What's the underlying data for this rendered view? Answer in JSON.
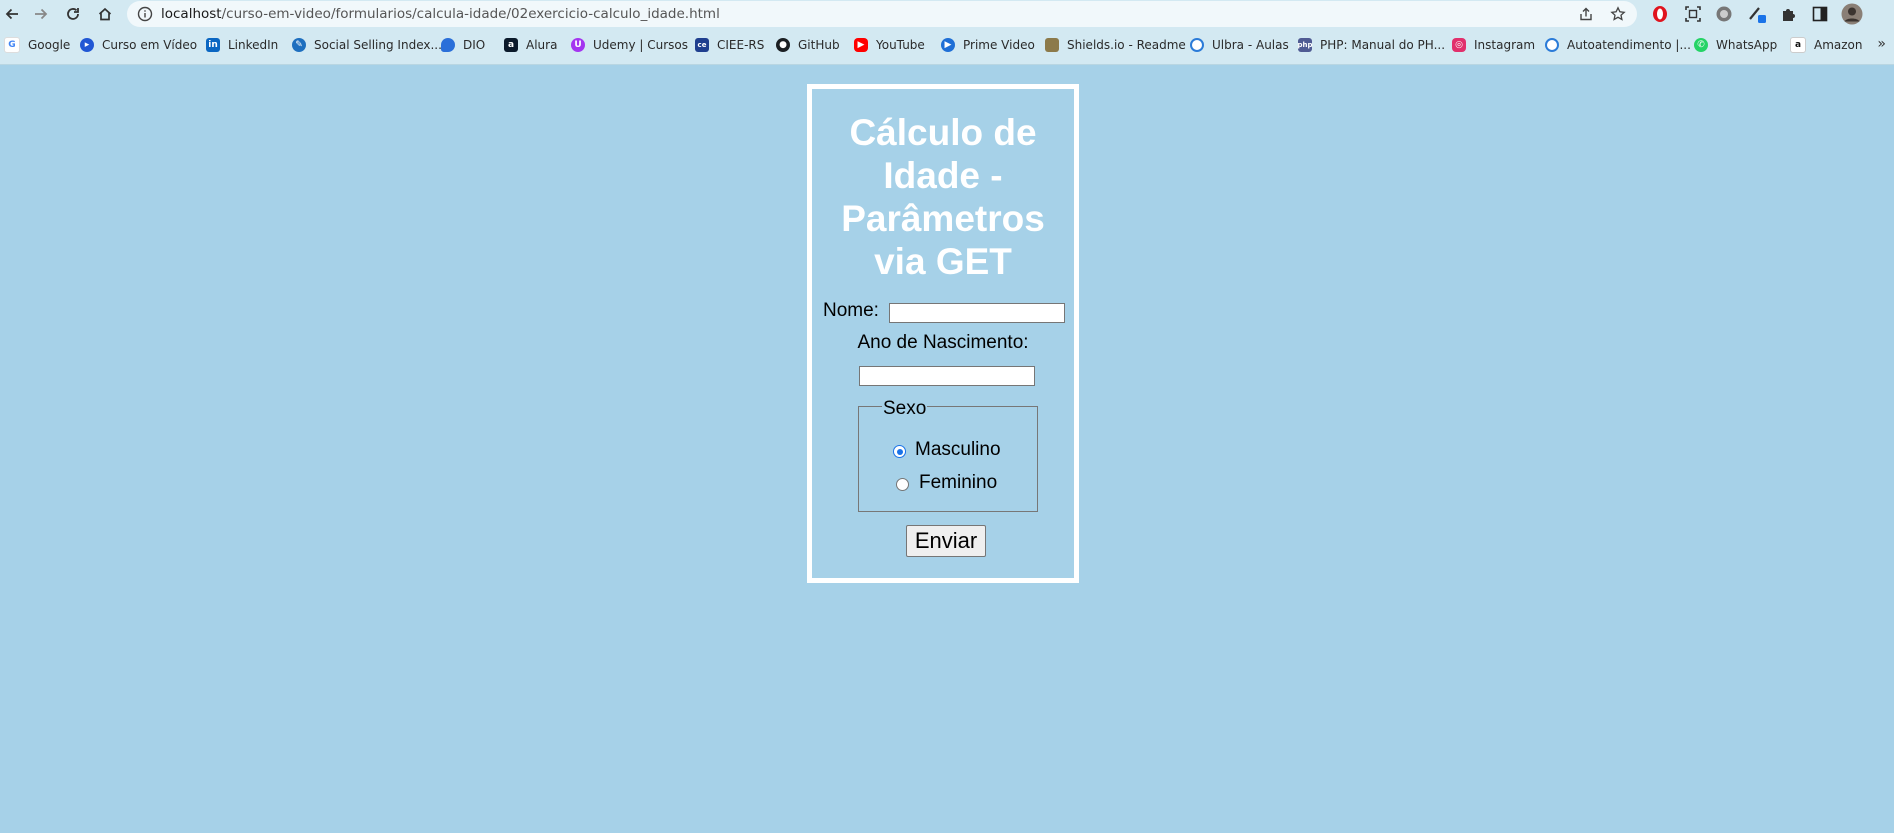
{
  "browser": {
    "url_host": "localhost",
    "url_path": "/curso-em-video/formularios/calcula-idade/02exercicio-calculo_idade.html",
    "bookmarks": [
      {
        "label": "Google",
        "icon": "google-icon",
        "color": "#4285f4"
      },
      {
        "label": "Curso em Vídeo",
        "icon": "cursoemvideo-icon",
        "color": "#2157d4"
      },
      {
        "label": "LinkedIn",
        "icon": "linkedin-icon",
        "color": "#0a66c2"
      },
      {
        "label": "Social Selling Index...",
        "icon": "social-selling-icon",
        "color": "#1e6fbf"
      },
      {
        "label": "DIO",
        "icon": "dio-icon",
        "color": "#2a6fd9"
      },
      {
        "label": "Alura",
        "icon": "alura-icon",
        "color": "#0b1a2b"
      },
      {
        "label": "Udemy | Cursos",
        "icon": "udemy-icon",
        "color": "#a435f0"
      },
      {
        "label": "CIEE-RS",
        "icon": "ciee-icon",
        "color": "#1f3f8f"
      },
      {
        "label": "GitHub",
        "icon": "github-icon",
        "color": "#1b1f23"
      },
      {
        "label": "YouTube",
        "icon": "youtube-icon",
        "color": "#ff0000"
      },
      {
        "label": "Prime Video",
        "icon": "prime-video-icon",
        "color": "#1f6fd6"
      },
      {
        "label": "Shields.io - Readme",
        "icon": "shields-icon",
        "color": "#8c7a4a"
      },
      {
        "label": "Ulbra - Aulas",
        "icon": "globe-icon",
        "color": "#2b7bd8"
      },
      {
        "label": "PHP: Manual do PH...",
        "icon": "php-icon",
        "color": "#4f5b93"
      },
      {
        "label": "Instagram",
        "icon": "instagram-icon",
        "color": "#e1306c"
      },
      {
        "label": "Autoatendimento |...",
        "icon": "globe-icon",
        "color": "#2b7bd8"
      },
      {
        "label": "WhatsApp",
        "icon": "whatsapp-icon",
        "color": "#25d366"
      },
      {
        "label": "Amazon",
        "icon": "amazon-icon",
        "color": "#111111"
      }
    ],
    "more_bookmarks": "»"
  },
  "page": {
    "title": "Cálculo de Idade - Parâmetros via GET",
    "nome_label": "Nome:",
    "nome_value": "",
    "ano_label": "Ano de Nascimento:",
    "ano_value": "",
    "sexo_legend": "Sexo",
    "options": [
      {
        "label": "Masculino",
        "checked": true
      },
      {
        "label": "Feminino",
        "checked": false
      }
    ],
    "submit_label": "Enviar"
  },
  "colors": {
    "page_background": "#a6d1e8",
    "panel_border": "#ffffff",
    "title_color": "#ffffff",
    "radio_accent": "#1a73e8"
  }
}
